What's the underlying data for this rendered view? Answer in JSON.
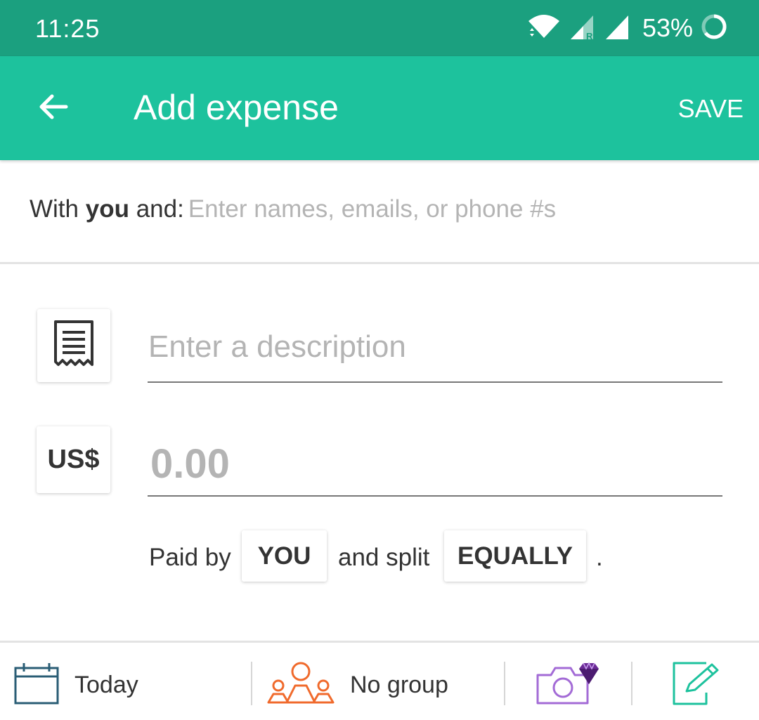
{
  "status_bar": {
    "time": "11:25",
    "battery_percent": "53%"
  },
  "toolbar": {
    "title": "Add expense",
    "save_label": "SAVE"
  },
  "with_row": {
    "prefix": "With ",
    "you": "you",
    "suffix": " and:",
    "placeholder": "Enter names, emails, or phone #s"
  },
  "description": {
    "placeholder": "Enter a description"
  },
  "amount": {
    "currency": "US$",
    "placeholder": "0.00"
  },
  "split": {
    "paid_by": "Paid by",
    "payer": "YOU",
    "and_split": "and split",
    "method": "EQUALLY",
    "period": "."
  },
  "bottom_bar": {
    "date_label": "Today",
    "group_label": "No group"
  },
  "colors": {
    "status_bar": "#1ba07f",
    "toolbar": "#1dc29d",
    "calendar_icon": "#2a5d75",
    "group_icon": "#f06a2c",
    "camera_icon": "#a36bd6",
    "gem_icon": "#6b2a96",
    "note_icon": "#1dc29d"
  },
  "icons": [
    "back-arrow-icon",
    "receipt-icon",
    "calendar-icon",
    "group-icon",
    "camera-icon",
    "gem-icon",
    "note-edit-icon",
    "wifi-icon",
    "signal-icon",
    "battery-icon"
  ]
}
